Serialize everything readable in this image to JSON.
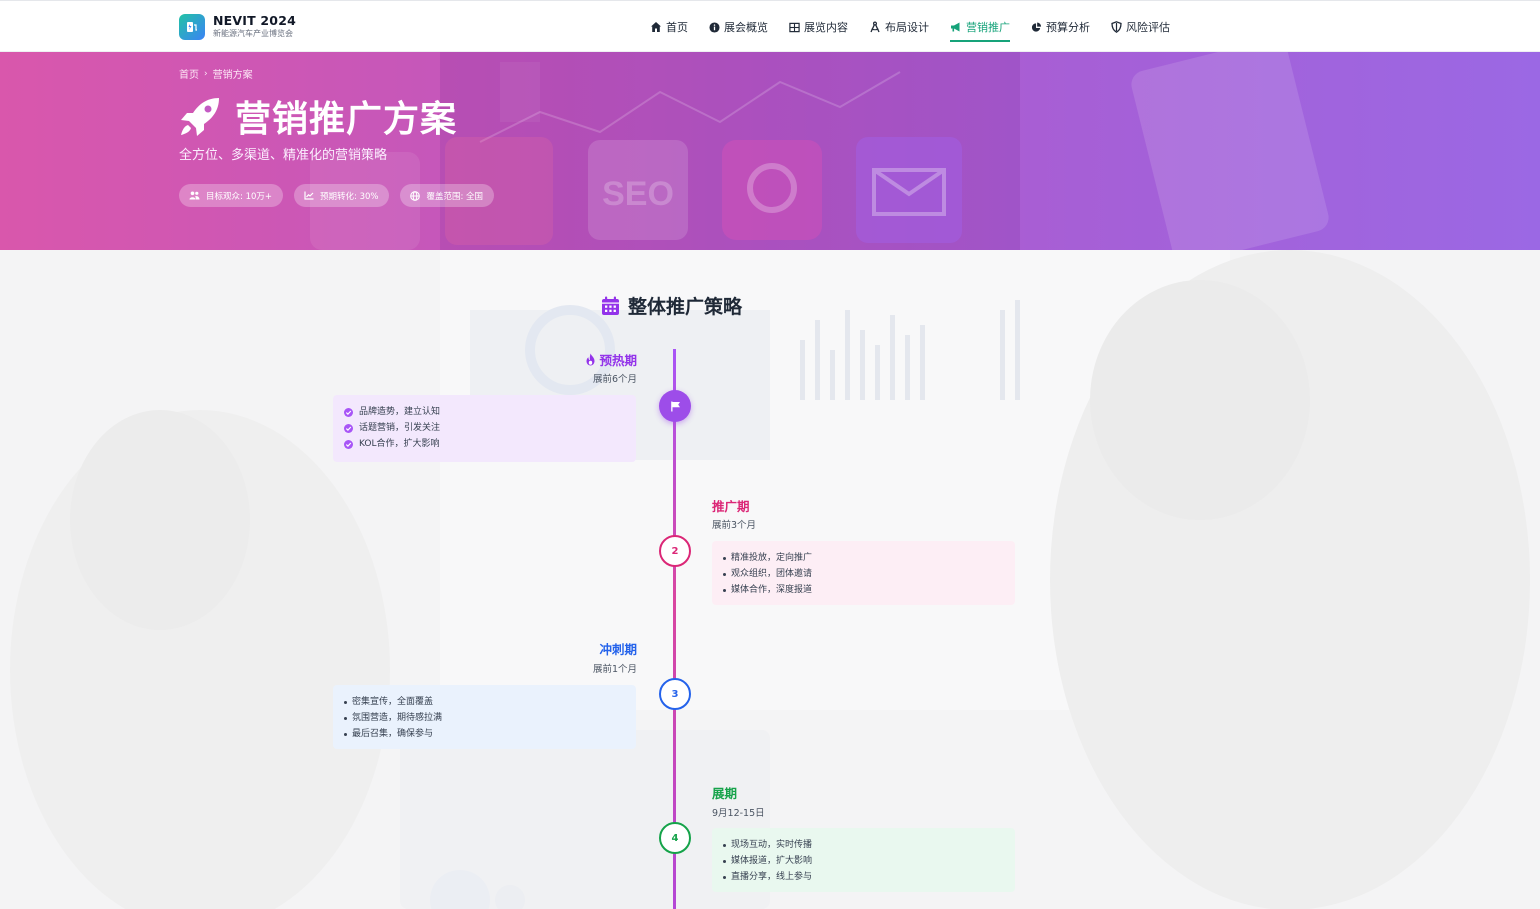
{
  "brand": {
    "title": "NEVIT 2024",
    "subtitle": "新能源汽车产业博览会"
  },
  "nav": [
    {
      "label": "首页",
      "icon": "home-icon"
    },
    {
      "label": "展会概览",
      "icon": "info-icon"
    },
    {
      "label": "展览内容",
      "icon": "grid-icon"
    },
    {
      "label": "布局设计",
      "icon": "compass-icon"
    },
    {
      "label": "营销推广",
      "icon": "megaphone-icon",
      "active": true
    },
    {
      "label": "预算分析",
      "icon": "pie-icon"
    },
    {
      "label": "风险评估",
      "icon": "shield-icon"
    }
  ],
  "hero": {
    "breadcrumb": [
      "首页",
      "营销方案"
    ],
    "title": "营销推广方案",
    "subtitle": "全方位、多渠道、精准化的营销策略",
    "chips": [
      {
        "label": "目标观众: 10万+",
        "icon": "users-icon"
      },
      {
        "label": "预期转化: 30%",
        "icon": "chart-line-icon"
      },
      {
        "label": "覆盖范围: 全国",
        "icon": "globe-icon"
      }
    ],
    "background_words": [
      "SEO"
    ]
  },
  "section": {
    "title": "整体推广策略",
    "icon": "calendar-icon"
  },
  "timeline": [
    {
      "name": "预热期",
      "time": "展前6个月",
      "node": "",
      "color": "#9333ea",
      "card_bg": "#f3e8fd",
      "items": [
        "品牌造势，建立认知",
        "话题营销，引发关注",
        "KOL合作，扩大影响"
      ]
    },
    {
      "name": "推广期",
      "time": "展前3个月",
      "node": "2",
      "color": "#db2777",
      "card_bg": "#fdeef5",
      "items": [
        "精准投放，定向推广",
        "观众组织，团体邀请",
        "媒体合作，深度报道"
      ]
    },
    {
      "name": "冲刺期",
      "time": "展前1个月",
      "node": "3",
      "color": "#2563eb",
      "card_bg": "#eaf2fd",
      "items": [
        "密集宣传，全面覆盖",
        "氛围营造，期待感拉满",
        "最后召集，确保参与"
      ]
    },
    {
      "name": "展期",
      "time": "9月12-15日",
      "node": "4",
      "color": "#16a34a",
      "card_bg": "#e9f8ef",
      "items": [
        "现场互动，实时传播",
        "媒体报道，扩大影响",
        "直播分享，线上参与"
      ]
    }
  ]
}
